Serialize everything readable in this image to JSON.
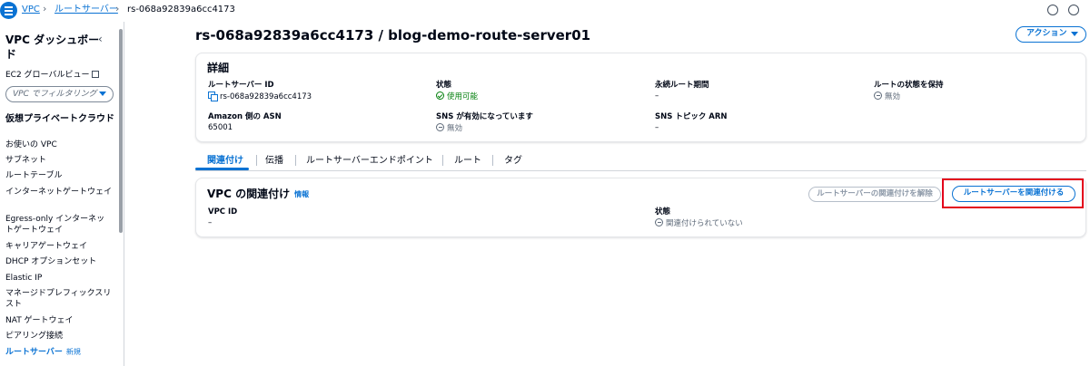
{
  "breadcrumb": {
    "items": [
      "VPC",
      "ルートサーバー",
      "rs-068a92839a6cc4173"
    ]
  },
  "sidebar": {
    "title": "VPC ダッシュボード",
    "collapse_glyph": "‹",
    "ec2_link": "EC2 グローバルビュー",
    "filter_placeholder": "VPC でフィルタリング",
    "section_title": "仮想プライベートクラウド",
    "items": [
      "お使いの VPC",
      "サブネット",
      "ルートテーブル",
      "インターネットゲートウェイ",
      "Egress-only インターネットゲートウェイ",
      "キャリアゲートウェイ",
      "DHCP オプションセット",
      "Elastic IP",
      "マネージドプレフィックスリスト",
      "NAT ゲートウェイ",
      "ピアリング接続",
      "ルートサーバー"
    ],
    "new_badge": "新規"
  },
  "page": {
    "title": "rs-068a92839a6cc4173 / blog-demo-route-server01",
    "actions_label": "アクション"
  },
  "details": {
    "title": "詳細",
    "fields": [
      {
        "label": "ルートサーバー ID",
        "value": "rs-068a92839a6cc4173"
      },
      {
        "label": "状態",
        "value": "使用可能"
      },
      {
        "label": "永続ルート期間",
        "value": "–"
      },
      {
        "label": "ルートの状態を保持",
        "value": "無効"
      },
      {
        "label": "Amazon 側の ASN",
        "value": "65001"
      },
      {
        "label": "SNS が有効になっています",
        "value": "無効"
      },
      {
        "label": "SNS トピック ARN",
        "value": "–"
      }
    ]
  },
  "tabs": [
    "関連付け",
    "伝播",
    "ルートサーバーエンドポイント",
    "ルート",
    "タグ"
  ],
  "association": {
    "title": "VPC の関連付け",
    "info": "情報",
    "disassociate_label": "ルートサーバーの関連付けを解除",
    "associate_label": "ルートサーバーを関連付ける",
    "vpc_id_label": "VPC ID",
    "vpc_id_value": "–",
    "status_label": "状態",
    "status_value": "関連付けられていない"
  },
  "colors": {
    "link": "#0972d3",
    "success": "#037f0c",
    "highlight": "#e3001b"
  }
}
